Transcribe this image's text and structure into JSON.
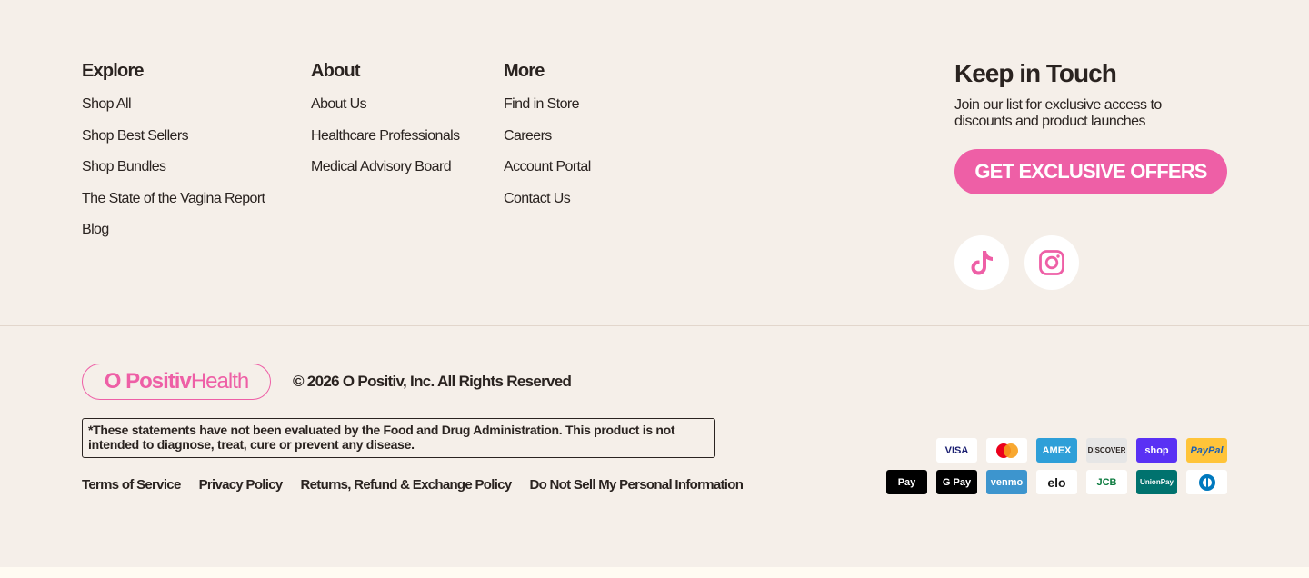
{
  "footer": {
    "explore": {
      "heading": "Explore",
      "links": [
        "Shop All",
        "Shop Best Sellers",
        "Shop Bundles",
        "The State of the Vagina Report",
        "Blog"
      ]
    },
    "about": {
      "heading": "About",
      "links": [
        "About Us",
        "Healthcare Professionals",
        "Medical Advisory Board"
      ]
    },
    "more": {
      "heading": "More",
      "links": [
        "Find in Store",
        "Careers",
        "Account Portal",
        "Contact Us"
      ]
    },
    "touch": {
      "heading": "Keep in Touch",
      "text": "Join our list for exclusive access to discounts and product launches",
      "button": "GET EXCLUSIVE OFFERS",
      "social": [
        "tiktok-icon",
        "instagram-icon"
      ]
    }
  },
  "bottom": {
    "logo_bold": "O Positiv",
    "logo_light": "Health",
    "copyright": "© 2026 O Positiv, Inc. All Rights Reserved",
    "disclaimer": "*These statements have not been evaluated by the Food and Drug Administration. This product is not intended to diagnose, treat, cure or prevent any disease.",
    "legal_links": [
      "Terms of Service",
      "Privacy Policy",
      "Returns, Refund & Exchange Policy",
      "Do Not Sell My Personal Information"
    ]
  },
  "payments": {
    "row1": [
      {
        "name": "visa",
        "label": "VISA",
        "bg": "#ffffff",
        "fg": "#1a1f71"
      },
      {
        "name": "mastercard",
        "label": "",
        "bg": "#ffffff",
        "fg": "#eb001b"
      },
      {
        "name": "amex",
        "label": "AMEX",
        "bg": "#2e9fd8",
        "fg": "#ffffff"
      },
      {
        "name": "discover",
        "label": "DISCOVER",
        "bg": "#e6e6e6",
        "fg": "#2a2320"
      },
      {
        "name": "shop-pay",
        "label": "shop",
        "bg": "#5a31f4",
        "fg": "#ffffff"
      },
      {
        "name": "paypal",
        "label": "PayPal",
        "bg": "#ffc439",
        "fg": "#1b5fb3"
      }
    ],
    "row2": [
      {
        "name": "apple-pay",
        "label": " Pay",
        "bg": "#000000",
        "fg": "#ffffff"
      },
      {
        "name": "google-pay",
        "label": "G Pay",
        "bg": "#000000",
        "fg": "#ffffff"
      },
      {
        "name": "venmo",
        "label": "venmo",
        "bg": "#3d95ce",
        "fg": "#ffffff"
      },
      {
        "name": "elo",
        "label": "elo",
        "bg": "#ffffff",
        "fg": "#1a1a1a"
      },
      {
        "name": "jcb",
        "label": "JCB",
        "bg": "#ffffff",
        "fg": "#0b7a3e"
      },
      {
        "name": "unionpay",
        "label": "UnionPay",
        "bg": "#00726e",
        "fg": "#ffffff"
      },
      {
        "name": "diners-club",
        "label": "",
        "bg": "#ffffff",
        "fg": "#0079be"
      }
    ]
  }
}
